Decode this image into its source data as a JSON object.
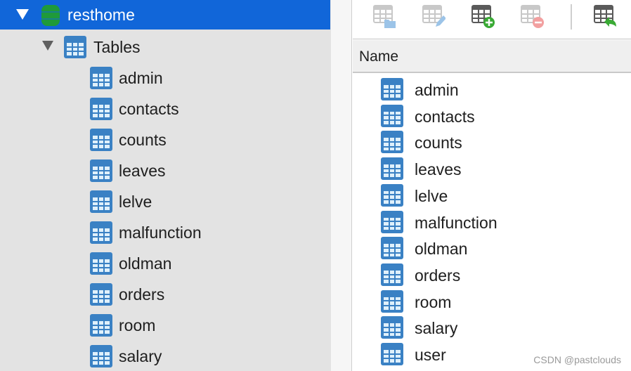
{
  "sidebar": {
    "database": {
      "name": "resthome",
      "icon": "database-icon",
      "expanded": true
    },
    "group": {
      "label": "Tables",
      "icon": "table-icon",
      "expanded": true
    },
    "items": [
      {
        "label": "admin"
      },
      {
        "label": "contacts"
      },
      {
        "label": "counts"
      },
      {
        "label": "leaves"
      },
      {
        "label": "lelve"
      },
      {
        "label": "malfunction"
      },
      {
        "label": "oldman"
      },
      {
        "label": "orders"
      },
      {
        "label": "room"
      },
      {
        "label": "salary"
      }
    ]
  },
  "toolbar": {
    "buttons": [
      {
        "name": "open-table",
        "icon": "table-folder-icon",
        "enabled": false
      },
      {
        "name": "design-table",
        "icon": "table-pencil-icon",
        "enabled": false
      },
      {
        "name": "new-table",
        "icon": "table-add-icon",
        "enabled": true
      },
      {
        "name": "delete-table",
        "icon": "table-delete-icon",
        "enabled": false
      },
      {
        "name": "import-table",
        "icon": "table-import-icon",
        "enabled": true
      }
    ]
  },
  "main": {
    "column_header": "Name",
    "items": [
      {
        "label": "admin"
      },
      {
        "label": "contacts"
      },
      {
        "label": "counts"
      },
      {
        "label": "leaves"
      },
      {
        "label": "lelve"
      },
      {
        "label": "malfunction"
      },
      {
        "label": "oldman"
      },
      {
        "label": "orders"
      },
      {
        "label": "room"
      },
      {
        "label": "salary"
      },
      {
        "label": "user"
      }
    ]
  },
  "watermark": "CSDN @pastclouds",
  "colors": {
    "selection": "#1166d9",
    "table_icon": "#3a81c4",
    "db_icon": "#1f9a3a",
    "add_green": "#3aaa35",
    "delete_red": "#f2a0a0"
  }
}
